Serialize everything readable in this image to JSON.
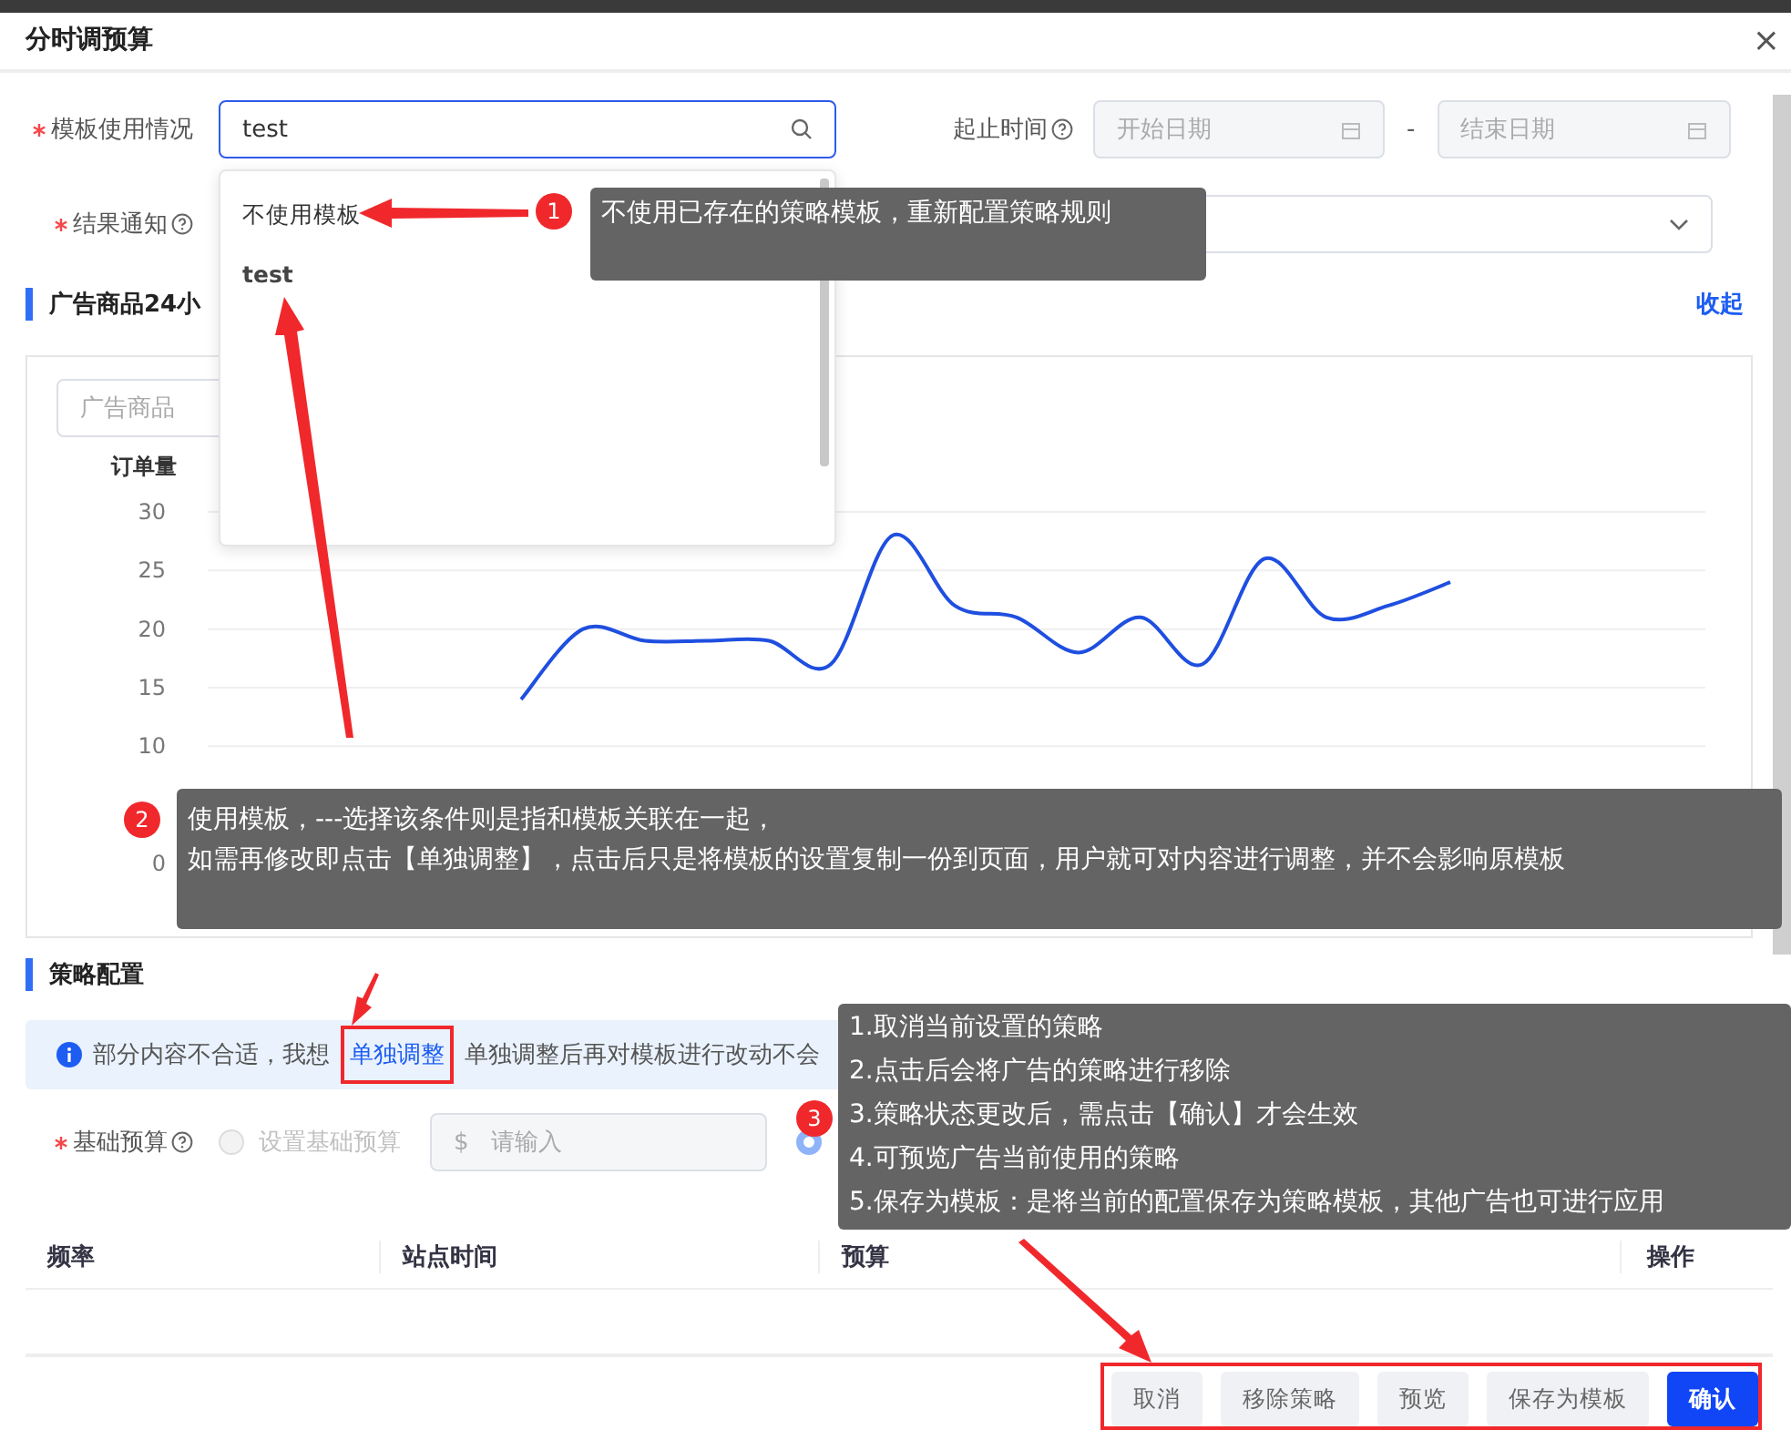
{
  "dialog": {
    "title": "分时调预算",
    "close": "×"
  },
  "form": {
    "template": {
      "label": "模板使用情况",
      "required": true,
      "value": "test"
    },
    "period": {
      "label": "起止时间",
      "start_placeholder": "开始日期",
      "separator": "-",
      "end_placeholder": "结束日期"
    },
    "notify": {
      "label": "结果通知",
      "required": true
    }
  },
  "template_dropdown": {
    "options": [
      {
        "label": "不使用模板",
        "selected": false
      },
      {
        "label": "test",
        "selected": true
      }
    ]
  },
  "chart_section": {
    "title": "广告商品24小",
    "collapse": "收起",
    "product_placeholder": "广告商品",
    "chart_data": {
      "type": "line",
      "ylabel": "订单量",
      "categories": [
        null,
        null,
        null,
        null,
        null,
        null,
        null,
        null,
        null,
        null,
        null,
        null,
        null,
        null,
        null,
        null,
        null,
        null,
        null,
        null,
        null,
        null,
        null,
        null
      ],
      "ylim": [
        0,
        30
      ],
      "yticks": [
        0,
        10,
        15,
        20,
        25,
        30
      ],
      "grid": true,
      "series": [
        {
          "color": "#1f4fe0",
          "values": [
            null,
            null,
            null,
            null,
            null,
            14,
            20,
            19,
            19,
            19,
            17,
            28,
            22,
            21,
            18,
            21,
            17,
            26,
            21,
            22,
            24,
            null,
            null,
            null
          ]
        }
      ]
    }
  },
  "strategy_section": {
    "title": "策略配置",
    "notice": {
      "before": "部分内容不合适，我想",
      "link": "单独调整",
      "after": "单独调整后再对模板进行改动不会"
    },
    "budget": {
      "label": "基础预算",
      "required": true,
      "options": [
        {
          "label": "设置基础预算",
          "selected": false,
          "disabled": true
        },
        {
          "selected": true,
          "disabled": false
        }
      ],
      "currency": "$",
      "placeholder": "请输入"
    },
    "table": {
      "columns": [
        "频率",
        "站点时间",
        "预算",
        "操作"
      ]
    }
  },
  "footer": {
    "buttons": [
      {
        "label": "取消",
        "kind": "default"
      },
      {
        "label": "移除策略",
        "kind": "default"
      },
      {
        "label": "预览",
        "kind": "default"
      },
      {
        "label": "保存为模板",
        "kind": "default"
      },
      {
        "label": "确认",
        "kind": "primary"
      }
    ]
  },
  "annotations": [
    {
      "number": "1",
      "lines": [
        "不使用已存在的策略模板，重新配置策略规则"
      ]
    },
    {
      "number": "2",
      "lines": [
        "使用模板，---选择该条件则是指和模板关联在一起，",
        "如需再修改即点击【单独调整】，点击后只是将模板的设置复制一份到页面，用户就可对内容进行调整，并不会影响原模板"
      ]
    },
    {
      "number": "3",
      "lines": [
        "1.取消当前设置的策略",
        "2.点击后会将广告的策略进行移除",
        "3.策略状态更改后，需点击【确认】才会生效",
        "4.可预览广告当前使用的策略",
        "5.保存为模板：是将当前的配置保存为策略模板，其他广告也可进行应用"
      ]
    }
  ]
}
